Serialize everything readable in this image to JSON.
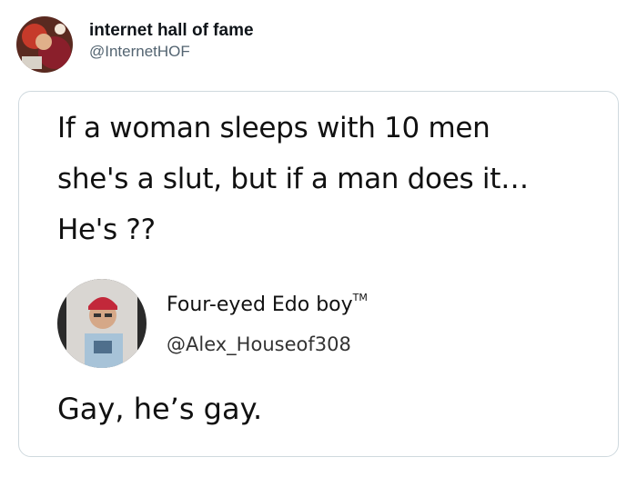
{
  "tweet": {
    "display_name": "internet hall of fame",
    "handle": "@InternetHOF",
    "avatar_icon": "user-avatar-icon"
  },
  "screenshot": {
    "question_lines": [
      "If a woman sleeps with 10 men",
      "she's a slut, but if a man does it…",
      "He's ??"
    ],
    "reply": {
      "display_name": "Four-eyed Edo boy",
      "trademark": "TM",
      "handle": "@Alex_Houseof308",
      "text": "Gay, he’s gay.",
      "avatar_icon": "user-avatar-icon"
    }
  },
  "colors": {
    "card_border": "#cfd9de",
    "handle_gray": "#536471"
  }
}
